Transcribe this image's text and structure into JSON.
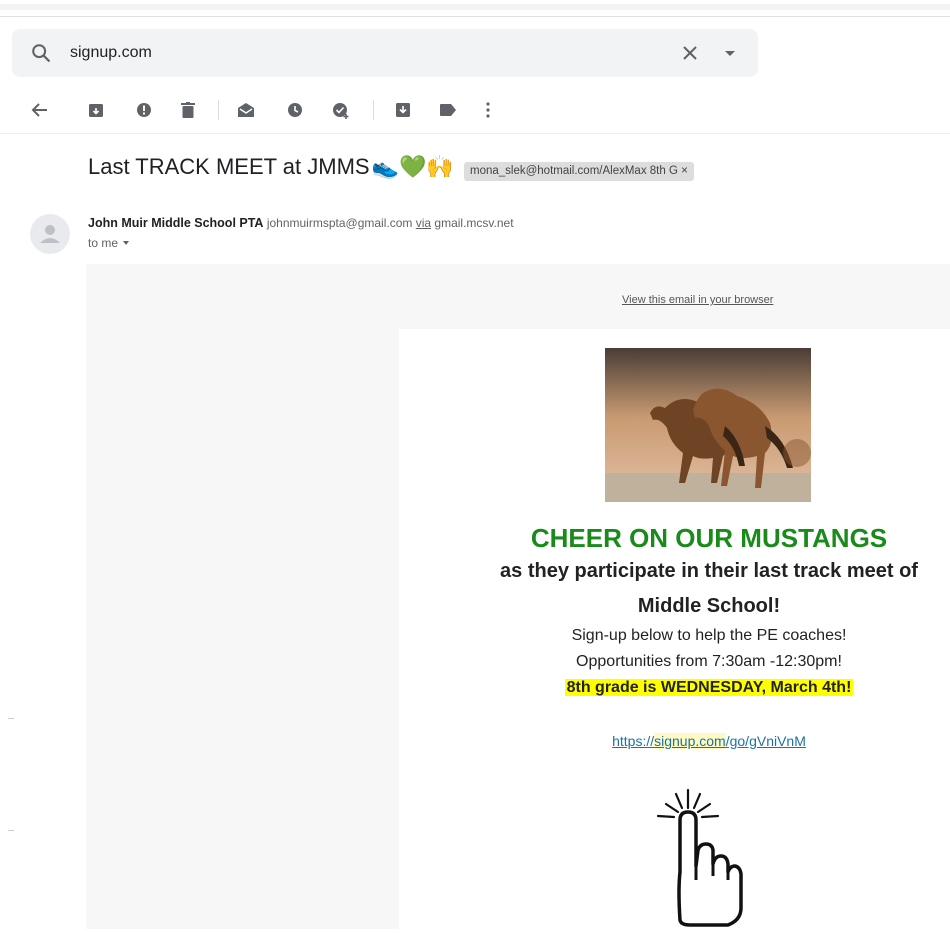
{
  "search": {
    "value": "signup.com",
    "icon": "search-icon"
  },
  "toolbar": {
    "icons": [
      "back-arrow-icon",
      "archive-icon",
      "report-spam-icon",
      "delete-icon",
      "mark-unread-icon",
      "snooze-icon",
      "add-task-icon",
      "move-to-icon",
      "label-icon",
      "more-icon"
    ]
  },
  "email": {
    "subject": "Last TRACK MEET at JMMS",
    "subject_emojis": "👟💚🙌",
    "label_chip": "mona_slek@hotmail.com/AlexMax 8th G",
    "label_chip_close": "×",
    "sender_name": "John Muir Middle School PTA",
    "sender_email": "johnmuirmspta@gmail.com",
    "via": "via",
    "via_domain": "gmail.mcsv.net",
    "to": "to me"
  },
  "body": {
    "view_in_browser": "View this email in your browser",
    "headline": "CHEER ON OUR MUSTANGS",
    "line2": "as they participate in their last track meet of",
    "line3": "Middle School!",
    "line4": "Sign-up below to help the PE coaches!",
    "line5": "Opportunities from 7:30am -12:30pm!",
    "highlight": "8th grade is WEDNESDAY, March 4th!",
    "link_prefix": "https://",
    "link_highlight": "signup.com",
    "link_suffix": "/go/gVniVnM"
  },
  "colors": {
    "headline": "#1a8a1a",
    "highlight_bg": "#ffff00",
    "link": "#1a73a0"
  }
}
